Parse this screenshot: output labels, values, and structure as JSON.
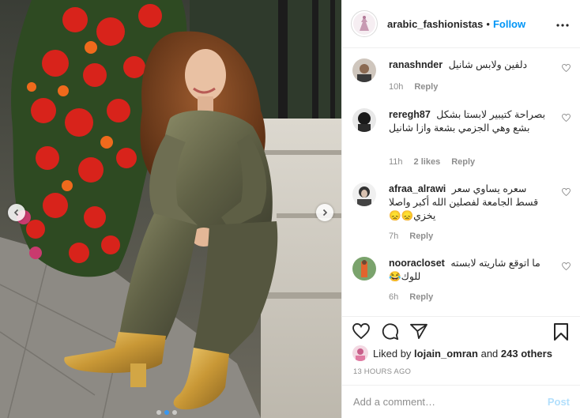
{
  "post": {
    "username": "arabic_fashionistas",
    "separator": "•",
    "follow_label": "Follow",
    "more_icon": "more-horizontal-icon"
  },
  "comments": [
    {
      "username": "ranashnder",
      "text": "دلفين ولابس شانيل",
      "age": "10h",
      "likes": "",
      "reply_label": "Reply"
    },
    {
      "username": "reregh87",
      "text": "بصراحة كتيبير لابستا بشكل بشع وهي الجزمي بشعة وازا شانيل",
      "age": "11h",
      "likes": "2 likes",
      "reply_label": "Reply"
    },
    {
      "username": "afraa_alrawi",
      "text": "سعره يساوي سعر قسط الجامعة لفصلين الله أكبر واصلا يخزي😞😞",
      "age": "7h",
      "likes": "",
      "reply_label": "Reply"
    },
    {
      "username": "nooracloset",
      "text": "ما اتوقع شاريته لابسته للوك😂",
      "age": "6h",
      "likes": "",
      "reply_label": "Reply"
    }
  ],
  "likes": {
    "prefix": "Liked by",
    "user": "lojain_omran",
    "conjunction": "and",
    "others": "243 others"
  },
  "timestamp": "13 HOURS AGO",
  "add_comment": {
    "placeholder": "Add a comment…",
    "post_label": "Post"
  },
  "carousel": {
    "slide_count": 3,
    "active_slide": 2
  },
  "colors": {
    "follow": "#0095f6",
    "post_disabled": "#b2dffc",
    "meta_gray": "#8e8e8e",
    "dot_active": "#3897f0"
  }
}
